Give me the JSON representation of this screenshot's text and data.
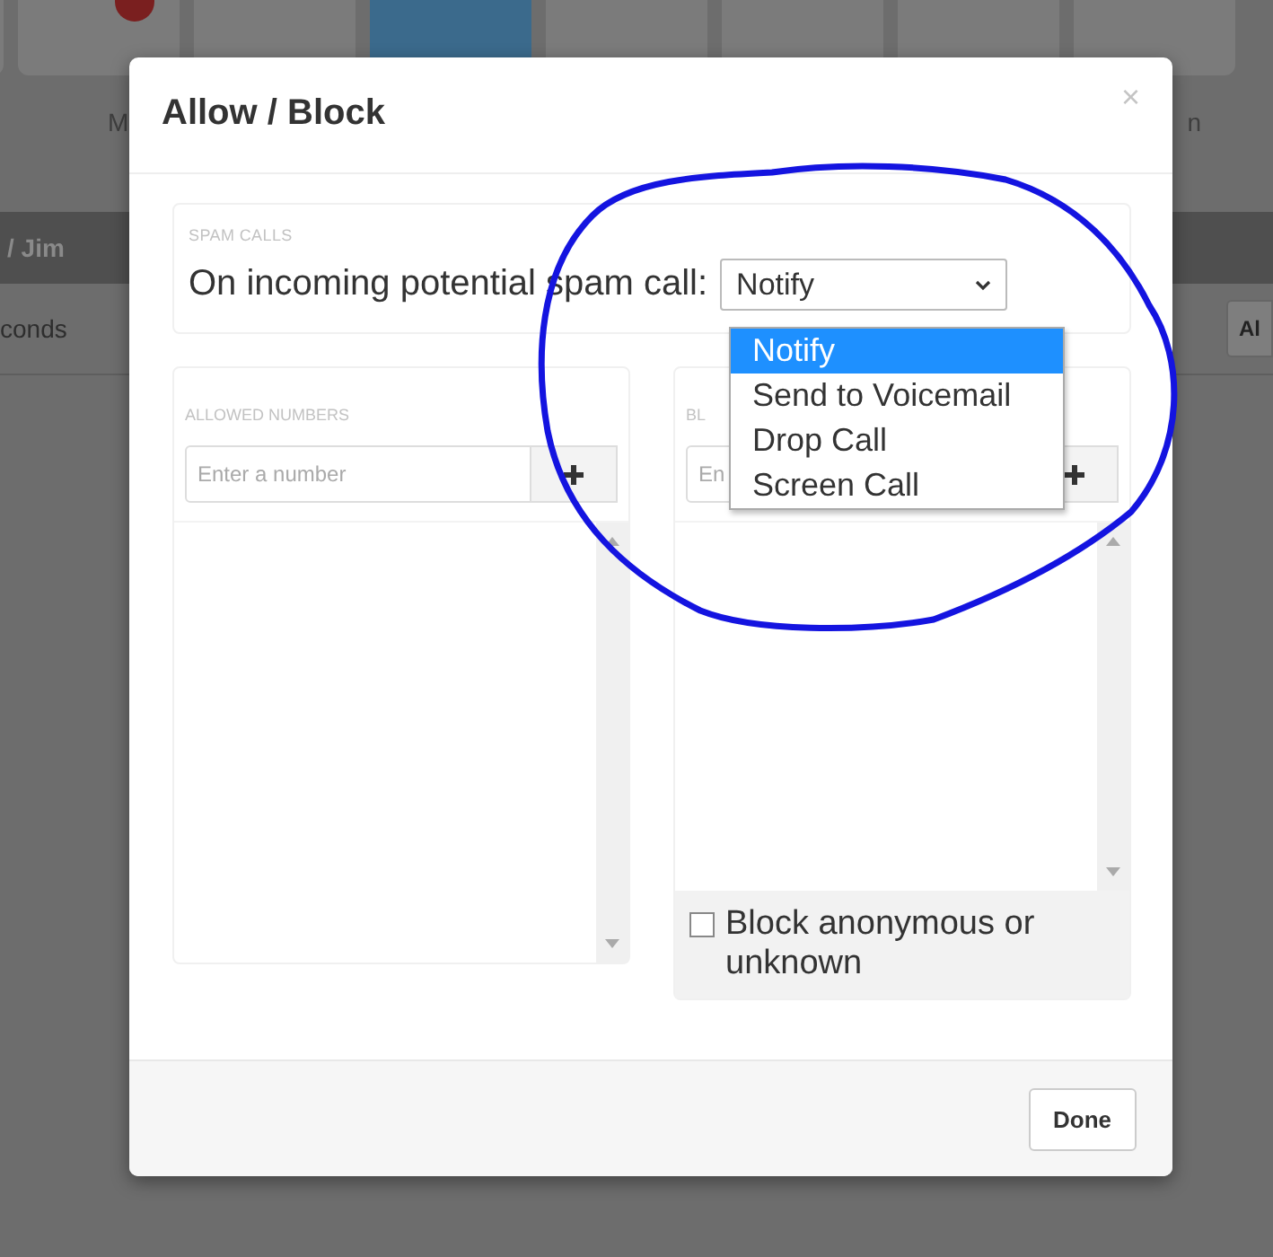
{
  "background": {
    "tiles": [
      {
        "selected": false,
        "badge": false
      },
      {
        "selected": false,
        "badge": true
      },
      {
        "selected": false,
        "badge": false
      },
      {
        "selected": true,
        "badge": false
      },
      {
        "selected": false,
        "badge": false
      },
      {
        "selected": false,
        "badge": false
      },
      {
        "selected": false,
        "badge": false
      },
      {
        "selected": false,
        "badge": false
      }
    ],
    "tile_labels": [
      "M",
      "n"
    ],
    "breadcrumb": "/  Jim",
    "toolbar_text": "conds",
    "toolbar_button": "Al"
  },
  "dialog": {
    "title": "Allow / Block",
    "close": "×",
    "spam": {
      "heading": "SPAM CALLS",
      "label": "On incoming potential spam call:",
      "select_value": "Notify",
      "options": [
        {
          "label": "Notify",
          "selected": true
        },
        {
          "label": "Send to Voicemail",
          "selected": false
        },
        {
          "label": "Drop Call",
          "selected": false
        },
        {
          "label": "Screen Call",
          "selected": false
        }
      ]
    },
    "allowed": {
      "heading": "ALLOWED NUMBERS",
      "placeholder": "Enter a number"
    },
    "blocked": {
      "heading": "BL",
      "placeholder": "En",
      "checkbox": {
        "label": "Block anonymous or unknown",
        "checked": false
      }
    },
    "done": "Done"
  }
}
